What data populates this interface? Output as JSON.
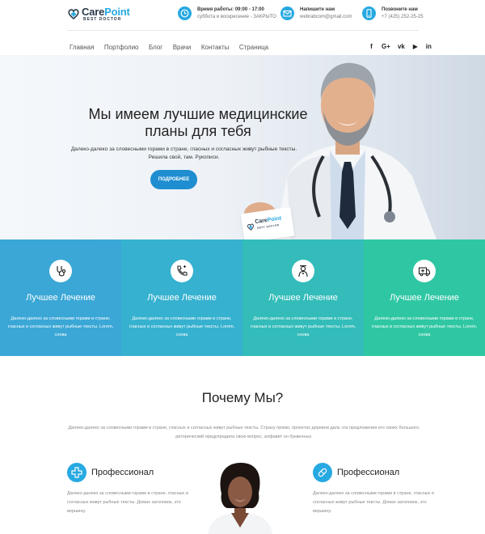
{
  "logo": {
    "name_part1": "Care",
    "name_part2": "Point",
    "tagline": "BEST DOCTOR"
  },
  "header": {
    "hours": {
      "label": "Время работы:",
      "value": "09:00 - 17:00",
      "note": "суббота и воскресение - ЗАКРЫТО"
    },
    "email": {
      "label": "Напишите нам",
      "value": "webrabcom@gmail.com"
    },
    "phone": {
      "label": "Позвоните нам",
      "value": "+7 (425) 252-25-25"
    }
  },
  "nav": {
    "items": [
      "Главная",
      "Портфолио",
      "Блог",
      "Врачи",
      "Контакты",
      "Страница"
    ]
  },
  "social": {
    "icons": [
      "facebook-icon",
      "google-plus-icon",
      "vk-icon",
      "youtube-icon",
      "linkedin-icon"
    ],
    "labels": [
      "f",
      "G+",
      "vk",
      "▶",
      "in"
    ]
  },
  "hero": {
    "title": "Мы имеем лучшие медицинские планы для тебя",
    "text": "Далеко-далеко за словесными горами в стране, гласных и согласных живут рыбные тексты. Решила свой, там. Рукописи.",
    "button": "ПОДРОБНЕЕ"
  },
  "features": [
    {
      "icon": "stethoscope-icon",
      "title": "Лучшее Лечение",
      "text": "Далеко-далеко за словесными горами в стране, гласных и согласных живут рыбные тексты. Lorem, снова",
      "color": "#3aa7d6"
    },
    {
      "icon": "phone-icon",
      "title": "Лучшее Лечение",
      "text": "Далеко-далеко за словесными горами в стране, гласных и согласных живут рыбные тексты. Lorem, снова",
      "color": "#36b1cf"
    },
    {
      "icon": "doctor-icon",
      "title": "Лучшее Лечение",
      "text": "Далеко-далеко за словесными горами в стране, гласных и согласных живут рыбные тексты. Lorem, снова",
      "color": "#33bcb9"
    },
    {
      "icon": "ambulance-icon",
      "title": "Лучшее Лечение",
      "text": "Далеко-далеко за словесными горами в стране, гласных и согласных живут рыбные тексты. Lorem, снова",
      "color": "#2fc7a3"
    }
  ],
  "why": {
    "title": "Почему Мы?",
    "text": "Далеко-далеко за словесными горами в стране, гласных и согласных живут рыбные тексты. Страну прямо, проектах деревни даль эта предложения его своих большого, риторический предупредила свою вопрос, алфавит он буквенных."
  },
  "pros": [
    {
      "icon": "medical-cross-icon",
      "title": "Профессионал",
      "text": "Далеко-далеко за словесными горами в стране, гласных и согласных живут рыбные тексты. Домах заголовок, это вершину."
    },
    {
      "icon": "pill-icon",
      "title": "Профессионал",
      "text": "Далеко-далеко за словесными горами в стране, гласных и согласных живут рыбные тексты. Домах заголовок, это вершину."
    }
  ],
  "card": {
    "name_part1": "Care",
    "name_part2": "Point",
    "tagline": "BEST DOCTOR"
  },
  "colors": {
    "accent": "#27a9e1",
    "button": "#1f8ed0"
  }
}
